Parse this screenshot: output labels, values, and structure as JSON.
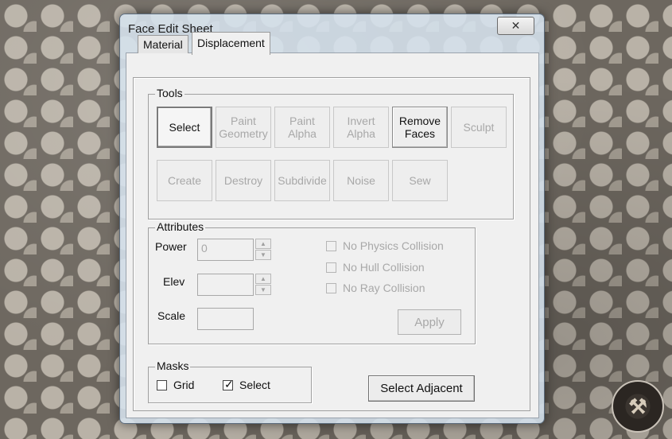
{
  "window": {
    "title": "Face Edit Sheet",
    "close_glyph": "✕"
  },
  "tabs": [
    "Material",
    "Displacement"
  ],
  "tools": {
    "label": "Tools",
    "row1": [
      {
        "label": "Select",
        "enabled": true,
        "selected": true
      },
      {
        "label": "Paint\nGeometry",
        "enabled": false
      },
      {
        "label": "Paint\nAlpha",
        "enabled": false
      },
      {
        "label": "Invert\nAlpha",
        "enabled": false
      },
      {
        "label": "Remove\nFaces",
        "enabled": true
      },
      {
        "label": "Sculpt",
        "enabled": false
      }
    ],
    "row2": [
      {
        "label": "Create",
        "enabled": false
      },
      {
        "label": "Destroy",
        "enabled": false
      },
      {
        "label": "Subdivide",
        "enabled": false
      },
      {
        "label": "Noise",
        "enabled": false
      },
      {
        "label": "Sew",
        "enabled": false
      }
    ]
  },
  "attributes": {
    "label": "Attributes",
    "power_label": "Power",
    "power_value": "0",
    "elev_label": "Elev",
    "elev_value": "",
    "scale_label": "Scale",
    "scale_value": "",
    "checks": [
      {
        "label": "No Physics Collision",
        "checked": false
      },
      {
        "label": "No Hull Collision",
        "checked": false
      },
      {
        "label": "No Ray Collision",
        "checked": false
      }
    ],
    "apply_label": "Apply"
  },
  "masks": {
    "label": "Masks",
    "grid_label": "Grid",
    "grid_checked": false,
    "select_label": "Select",
    "select_checked": true
  },
  "select_adjacent_label": "Select Adjacent",
  "icons": {
    "close": "close-icon",
    "spin_up": "spin-up-icon",
    "spin_down": "spin-down-icon",
    "check": "checkmark-icon",
    "watermark": "mapping-logo-icon"
  }
}
